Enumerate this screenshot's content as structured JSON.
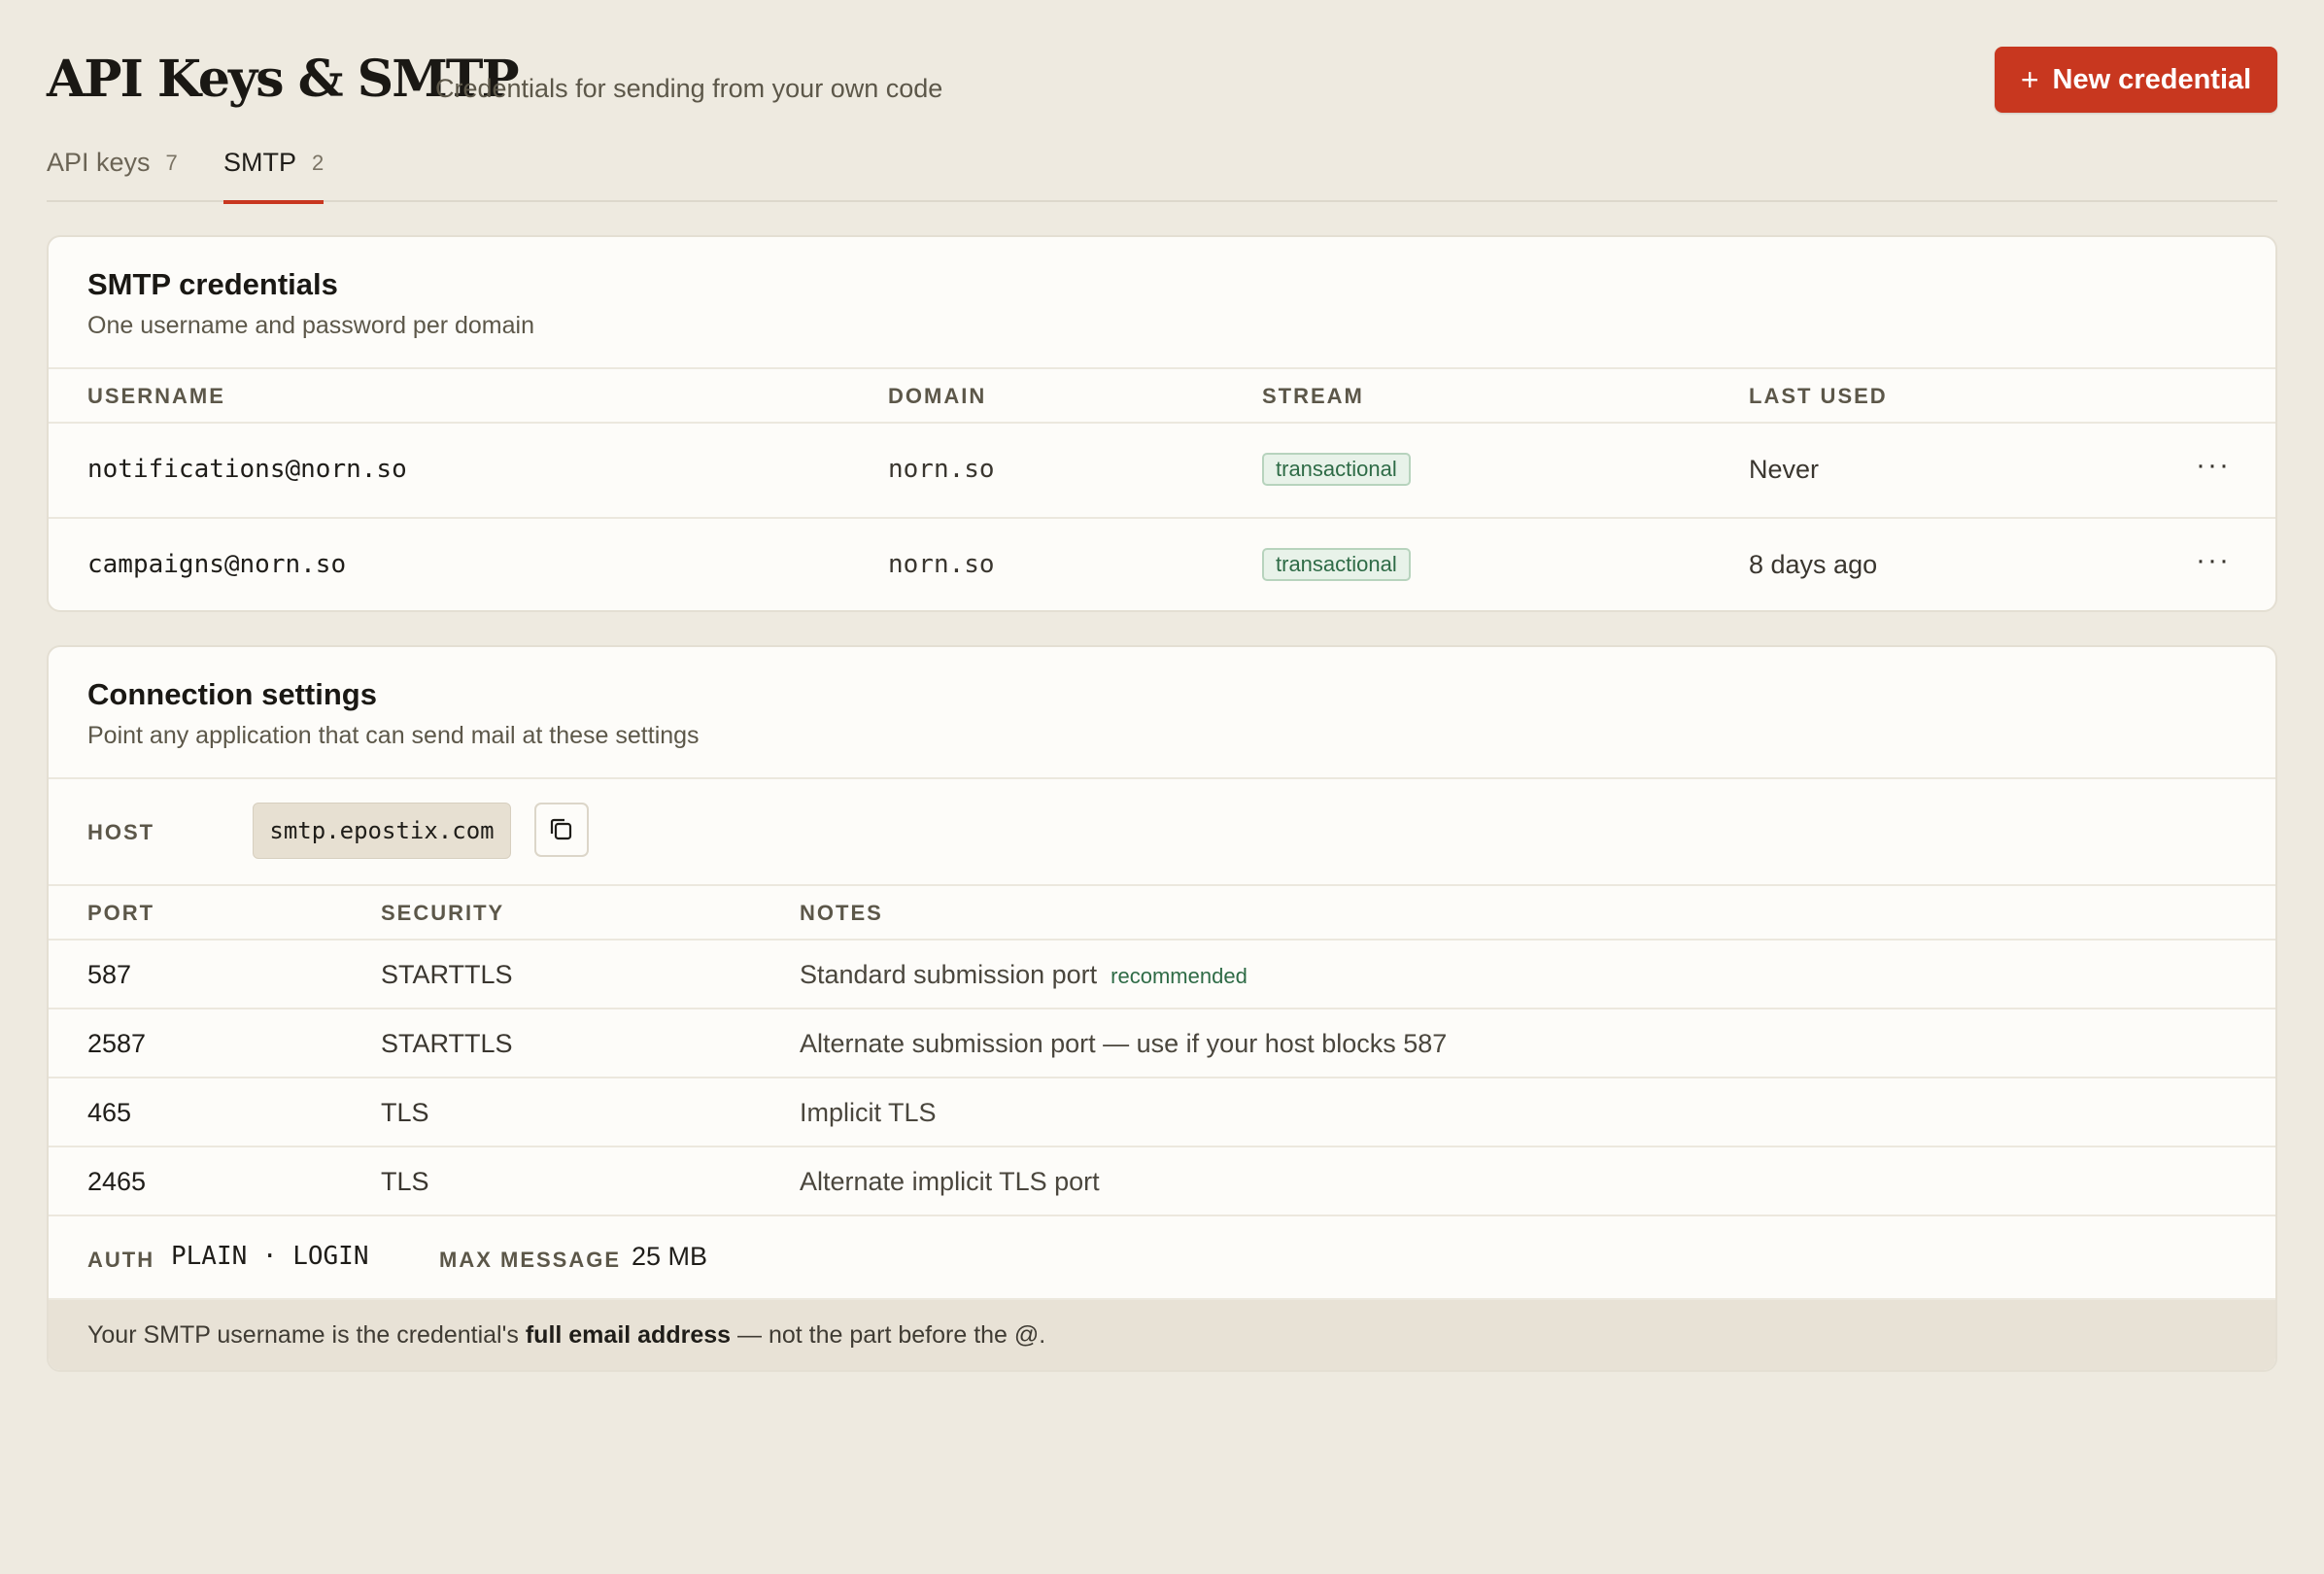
{
  "header": {
    "title": "API Keys & SMTP",
    "subtitle": "Credentials for sending from your own code",
    "new_button_label": "New credential",
    "new_button_icon": "plus-icon"
  },
  "tabs": [
    {
      "label": "API keys",
      "count": "7",
      "active": false
    },
    {
      "label": "SMTP",
      "count": "2",
      "active": true
    }
  ],
  "credentials": {
    "title": "SMTP credentials",
    "subtitle": "One username and password per domain",
    "columns": [
      "USERNAME",
      "DOMAIN",
      "STREAM",
      "LAST USED"
    ],
    "rows": [
      {
        "username": "notifications@norn.so",
        "domain": "norn.so",
        "stream": "transactional",
        "last_used": "Never"
      },
      {
        "username": "campaigns@norn.so",
        "domain": "norn.so",
        "stream": "transactional",
        "last_used": "8 days ago"
      }
    ],
    "row_menu_icon": "more-horizontal-icon"
  },
  "connection": {
    "title": "Connection settings",
    "subtitle": "Point any application that can send mail at these settings",
    "host_label": "HOST",
    "host_value": "smtp.epostix.com",
    "copy_icon": "copy-icon",
    "columns": [
      "PORT",
      "SECURITY",
      "NOTES"
    ],
    "ports": [
      {
        "port": "587",
        "security": "STARTTLS",
        "notes": "Standard submission port",
        "tag": "recommended"
      },
      {
        "port": "2587",
        "security": "STARTTLS",
        "notes": "Alternate submission port — use if your host blocks 587",
        "tag": ""
      },
      {
        "port": "465",
        "security": "TLS",
        "notes": "Implicit TLS",
        "tag": ""
      },
      {
        "port": "2465",
        "security": "TLS",
        "notes": "Alternate implicit TLS port",
        "tag": ""
      }
    ],
    "auth_label": "AUTH",
    "auth_value": "PLAIN · LOGIN",
    "max_label": "MAX MESSAGE",
    "max_value": "25 MB",
    "note_prefix": "Your SMTP username is the credential's ",
    "note_bold": "full email address",
    "note_suffix": " — not the part before the @."
  },
  "colors": {
    "background": "#eeeae0",
    "accent": "#c8371f",
    "success": "#2e6b46"
  }
}
